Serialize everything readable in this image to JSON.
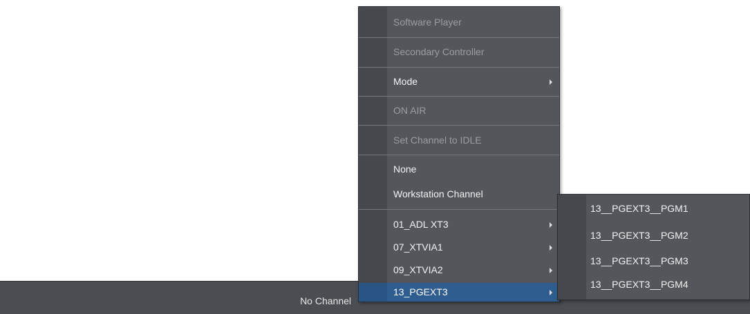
{
  "status_bar": {
    "channel_text": "No Channel"
  },
  "context_menu": {
    "items": [
      {
        "label": "Software Player",
        "disabled": true
      },
      {
        "label": "Secondary Controller",
        "disabled": true
      },
      {
        "label": "Mode",
        "submenu": true
      },
      {
        "label": "ON AIR",
        "disabled": true
      },
      {
        "label": "Set Channel to IDLE",
        "disabled": true
      },
      {
        "label": "None"
      },
      {
        "label": "Workstation Channel"
      },
      {
        "label": "01_ADL XT3",
        "submenu": true
      },
      {
        "label": "07_XTVIA1",
        "submenu": true
      },
      {
        "label": "09_XTVIA2",
        "submenu": true
      },
      {
        "label": "13_PGEXT3",
        "submenu": true,
        "highlighted": true
      }
    ]
  },
  "submenu": {
    "items": [
      {
        "label": "13__PGEXT3__PGM1"
      },
      {
        "label": "13__PGEXT3__PGM2"
      },
      {
        "label": "13__PGEXT3__PGM3"
      },
      {
        "label": "13__PGEXT3__PGM4"
      }
    ]
  },
  "colors": {
    "menu_bg": "#53565b",
    "highlight": "#2f5d8f",
    "disabled_text": "#9a9da2",
    "status_bar_bg": "#4a4d52"
  }
}
